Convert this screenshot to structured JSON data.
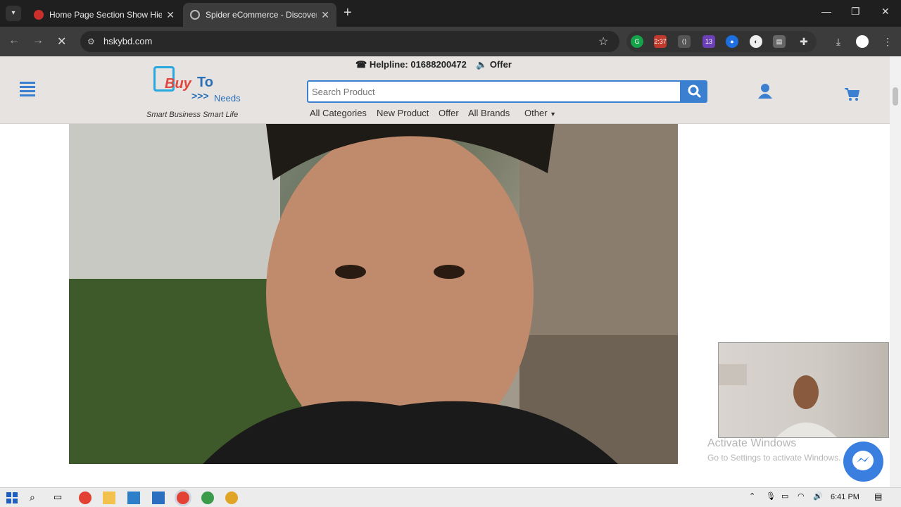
{
  "browser": {
    "tabs": [
      {
        "title": "Home Page Section Show Hied",
        "active": false,
        "favicon_color": "#c9302c"
      },
      {
        "title": "Spider eCommerce - Discover a",
        "active": true,
        "favicon_color": "#e0e0e0"
      }
    ],
    "address": "hskybd.com",
    "extension_badges": {
      "counter": "2:37",
      "count13": "13"
    }
  },
  "site": {
    "logo": {
      "buy": "Buy",
      "to": "To",
      "arrows": ">>>",
      "needs": "Needs"
    },
    "tagline": "Smart Business Smart Life",
    "helpline": "Helpline: 01688200472",
    "offer": "Offer",
    "search": {
      "placeholder": "Search Product"
    },
    "nav": [
      "All Categories",
      "New Product",
      "Offer",
      "All Brands",
      "Other"
    ]
  },
  "overlays": {
    "activate_title": "Activate Windows",
    "activate_sub": "Go to Settings to activate Windows."
  },
  "taskbar": {
    "time": "6:41 PM"
  },
  "colors": {
    "accent": "#3a7fd0",
    "header_bg": "#e6e3e1",
    "browser_dark": "#1f1f1f"
  }
}
